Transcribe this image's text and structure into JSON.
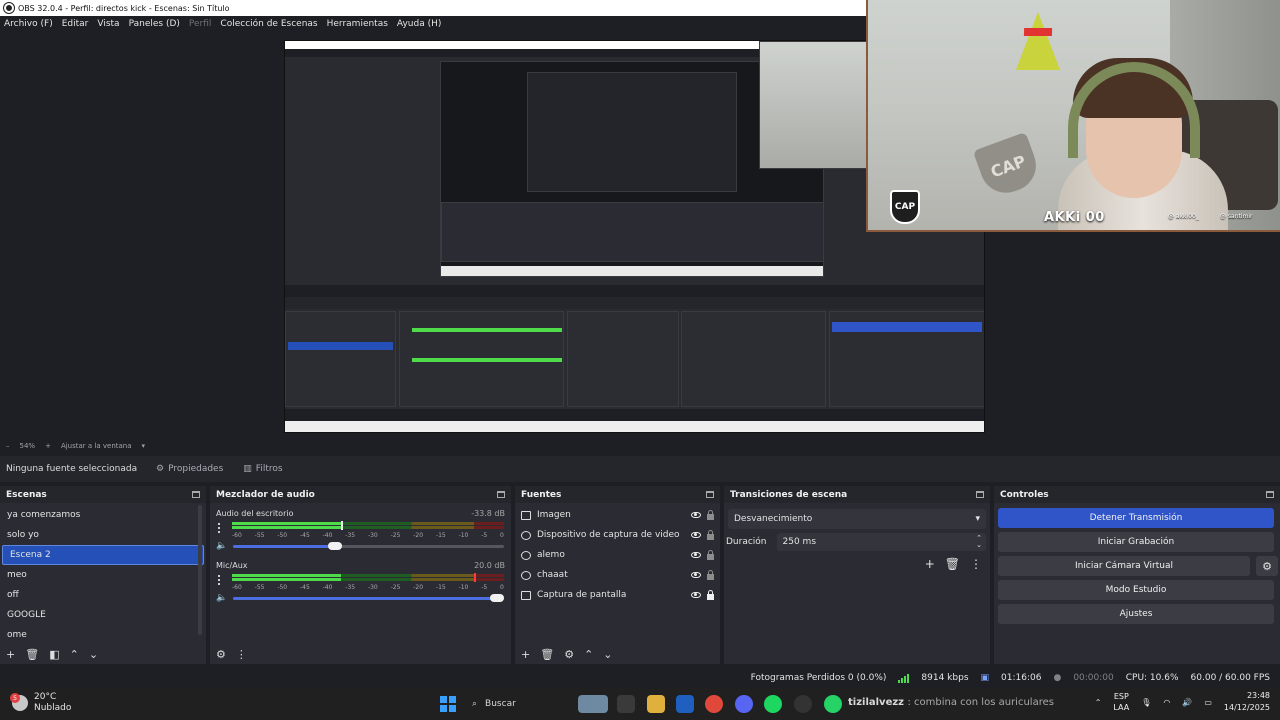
{
  "window": {
    "title": "OBS 32.0.4 - Perfil: directos kick - Escenas: Sin Título"
  },
  "menu": [
    "Archivo (F)",
    "Editar",
    "Vista",
    "Paneles (D)",
    "Perfil",
    "Colección de Escenas",
    "Herramientas",
    "Ayuda (H)"
  ],
  "zoom": {
    "value": "54%",
    "fit_label": "Ajustar a la ventana"
  },
  "source_toolbar": {
    "selection": "Ninguna fuente seleccionada",
    "properties": "Propiedades",
    "filters": "Filtros"
  },
  "webcam_overlay": {
    "name_tag": "AKKi 00",
    "social_1": "@ akki00_",
    "social_2": "@ santimir",
    "wall_text": "CAP",
    "badge": "CAP"
  },
  "scenes": {
    "title": "Escenas",
    "items": [
      "ya comenzamos",
      "solo yo",
      "Escena 2",
      "meo",
      "off",
      "GOOGLE",
      "ome"
    ],
    "active": "Escena 2"
  },
  "audio_mixer": {
    "title": "Mezclador de audio",
    "ticks": [
      "-60",
      "-55",
      "-50",
      "-45",
      "-40",
      "-35",
      "-30",
      "-25",
      "-20",
      "-15",
      "-10",
      "-5",
      "0"
    ],
    "channels": [
      {
        "name": "Audio del escritorio",
        "db": "-33.8 dB",
        "level": 0.4,
        "peak": 0.4,
        "volume": 0.4
      },
      {
        "name": "Mic/Aux",
        "db": "20.0 dB",
        "level": 0.4,
        "peak": 0.89,
        "volume": 1.0
      }
    ]
  },
  "sources": {
    "title": "Fuentes",
    "items": [
      {
        "name": "Imagen",
        "icon": "image-icon",
        "locked": false
      },
      {
        "name": "Dispositivo de captura de video",
        "icon": "camera-icon",
        "locked": false
      },
      {
        "name": "alemo",
        "icon": "browser-icon",
        "locked": false
      },
      {
        "name": "chaaat",
        "icon": "browser-icon",
        "locked": false
      },
      {
        "name": "Captura de pantalla",
        "icon": "monitor-icon",
        "locked": true
      }
    ]
  },
  "transitions": {
    "title": "Transiciones de escena",
    "selected": "Desvanecimiento",
    "duration_label": "Duración",
    "duration_value": "250 ms"
  },
  "controls": {
    "title": "Controles",
    "stop_stream": "Detener Transmisión",
    "start_recording": "Iniciar Grabación",
    "virtual_camera": "Iniciar Cámara Virtual",
    "studio_mode": "Modo Estudio",
    "settings": "Ajustes"
  },
  "status": {
    "dropped_frames": "Fotogramas Perdidos 0 (0.0%)",
    "bitrate": "8914 kbps",
    "stream_time": "01:16:06",
    "rec_time": "00:00:00",
    "cpu": "CPU: 10.6%",
    "fps": "60.00 / 60.00 FPS"
  },
  "taskbar": {
    "weather_temp": "20°C",
    "weather_desc": "Nublado",
    "weather_badge": "5",
    "search_label": "Buscar",
    "now_playing_user": "tizilalvezz",
    "now_playing_text": ": combina con los auriculares",
    "lang": "ESP",
    "lang_sub": "LAA",
    "time": "23:48",
    "date": "14/12/2025"
  },
  "colors": {
    "accent": "#2f55c8",
    "panel": "#2b2c33",
    "background": "#1e1f24",
    "meter_green": "#4fdc4a"
  }
}
